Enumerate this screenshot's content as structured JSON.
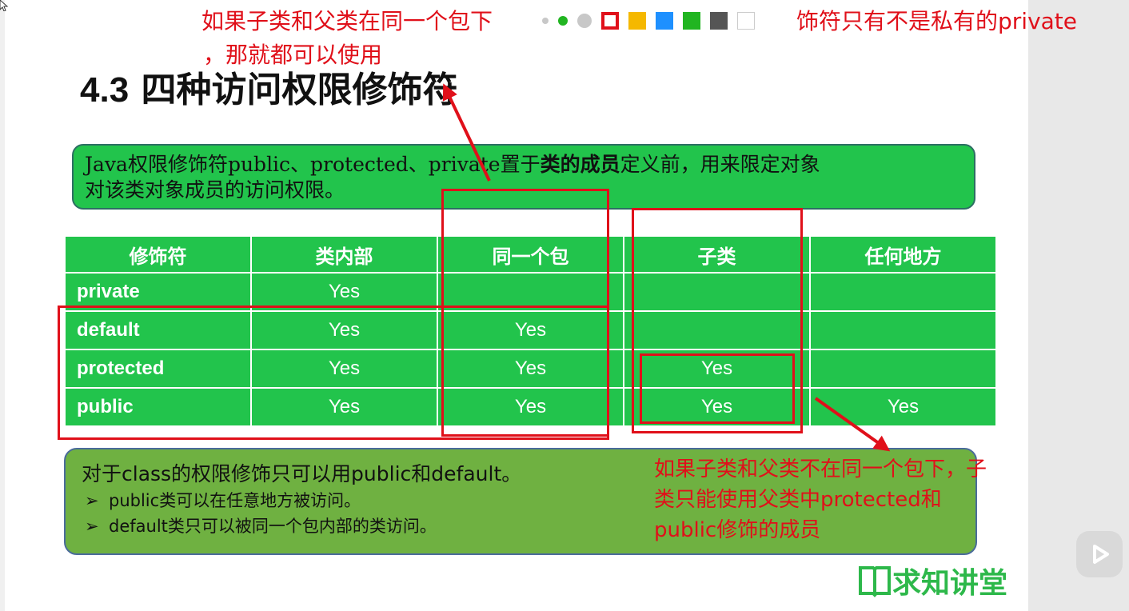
{
  "slide": {
    "title_num": "4.3",
    "title_text": "四种访问权限修饰符",
    "intro_line1_a": "Java权限修饰符public、protected、private置于",
    "intro_line1_bold": "类的成员",
    "intro_line1_b": "定义前，用来限定对象",
    "intro_line2": "对该类对象成员的访问权限。"
  },
  "table": {
    "headers": [
      "修饰符",
      "类内部",
      "同一个包",
      "子类",
      "任何地方"
    ],
    "rows": [
      [
        "private",
        "Yes",
        "",
        "",
        ""
      ],
      [
        "default",
        "Yes",
        "Yes",
        "",
        ""
      ],
      [
        "protected",
        "Yes",
        "Yes",
        "Yes",
        ""
      ],
      [
        "public",
        "Yes",
        "Yes",
        "Yes",
        "Yes"
      ]
    ]
  },
  "note": {
    "main": "对于class的权限修饰只可以用public和default。",
    "bullet_symbol": "➢",
    "items": [
      "public类可以在任意地方被访问。",
      "default类只可以被同一个包内部的类访问。"
    ]
  },
  "annotations": {
    "top_line1_left": "如果子类和父类在同一个包下",
    "top_line1_right": "饰符只有不是私有的private",
    "top_line2": "，那就都可以使用",
    "bottom": "如果子类和父类不在同一个包下，子类只能使用父类中protected和public修饰的成员"
  },
  "toolbar": {
    "colors": [
      "#e0101a",
      "#f5b800",
      "#1e90ff",
      "#21b521",
      "#555555",
      "#ffffff"
    ]
  },
  "logo": {
    "text": "求知讲堂"
  },
  "colors": {
    "accent_red": "#e0101a",
    "table_green": "#22c44c",
    "note_green": "#6fb141"
  }
}
